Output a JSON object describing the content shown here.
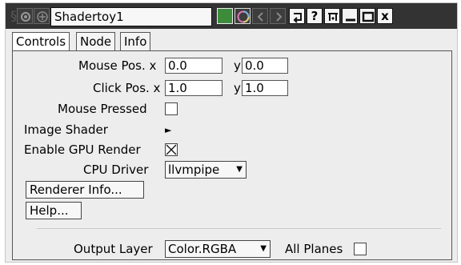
{
  "window": {
    "name": "Shadertoy1"
  },
  "titlebar": {
    "question_glyph": "?",
    "close_glyph": "x"
  },
  "tabs": [
    {
      "label": "Controls"
    },
    {
      "label": "Node"
    },
    {
      "label": "Info"
    }
  ],
  "controls": {
    "mouse_pos": {
      "label": "Mouse Pos. x",
      "x": "0.0",
      "y_label": "y",
      "y": "0.0"
    },
    "click_pos": {
      "label": "Click Pos. x",
      "x": "1.0",
      "y_label": "y",
      "y": "1.0"
    },
    "mouse_pressed": {
      "label": "Mouse Pressed",
      "checked": false
    },
    "image_shader": {
      "label": "Image Shader",
      "arrow": "►"
    },
    "enable_gpu": {
      "label": "Enable GPU Render",
      "checked": true
    },
    "cpu_driver": {
      "label": "CPU Driver",
      "value": "llvmpipe",
      "arrow": "▼"
    },
    "renderer_info_button": "Renderer Info...",
    "help_button": "Help...",
    "output_layer": {
      "label": "Output Layer",
      "value": "Color.RGBA",
      "arrow": "▼"
    },
    "all_planes": {
      "label": "All Planes",
      "checked": false
    }
  },
  "colors": {
    "titlebar_bg": "#333333",
    "node_color_swatch": "#3c8c3c",
    "panel_bg": "#ededed"
  }
}
